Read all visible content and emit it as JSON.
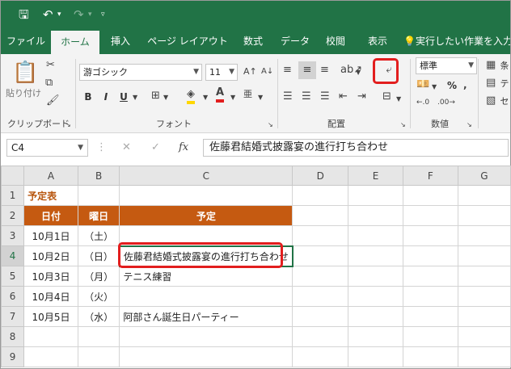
{
  "ribbon_tabs": [
    "ファイル",
    "ホーム",
    "挿入",
    "ページ レイアウト",
    "数式",
    "データ",
    "校閲",
    "表示"
  ],
  "tell_me": "実行したい作業を入力",
  "clipboard": {
    "paste": "貼り付け",
    "group": "クリップボード"
  },
  "font": {
    "name": "游ゴシック",
    "size": "11",
    "group": "フォント",
    "bold": "B",
    "italic": "I",
    "underline": "U"
  },
  "alignment": {
    "group": "配置"
  },
  "number": {
    "format": "標準",
    "group": "数値",
    "percent": "%"
  },
  "styles": {
    "conditional": "条",
    "table": "テ",
    "cell": "セ"
  },
  "formula": {
    "cell_ref": "C4",
    "content": "佐藤君結婚式披露宴の進行打ち合わせ",
    "fx": "fx"
  },
  "columns": [
    "A",
    "B",
    "C",
    "D",
    "E",
    "F",
    "G"
  ],
  "rows": [
    "1",
    "2",
    "3",
    "4",
    "5",
    "6",
    "7",
    "8",
    "9"
  ],
  "cells": {
    "title": "予定表",
    "h_date": "日付",
    "h_day": "曜日",
    "h_plan": "予定",
    "r3": {
      "date": "10月1日",
      "day": "（土）",
      "plan": ""
    },
    "r4": {
      "date": "10月2日",
      "day": "（日）",
      "plan": "佐藤君結婚式披露宴の進行打ち合わせ"
    },
    "r5": {
      "date": "10月3日",
      "day": "（月）",
      "plan": "テニス練習"
    },
    "r6": {
      "date": "10月4日",
      "day": "（火）",
      "plan": ""
    },
    "r7": {
      "date": "10月5日",
      "day": "（水）",
      "plan": "阿部さん誕生日パーティー"
    }
  },
  "colors": {
    "excel_green": "#217346",
    "header_orange": "#c55a11",
    "highlight_red": "#e21e1e"
  }
}
